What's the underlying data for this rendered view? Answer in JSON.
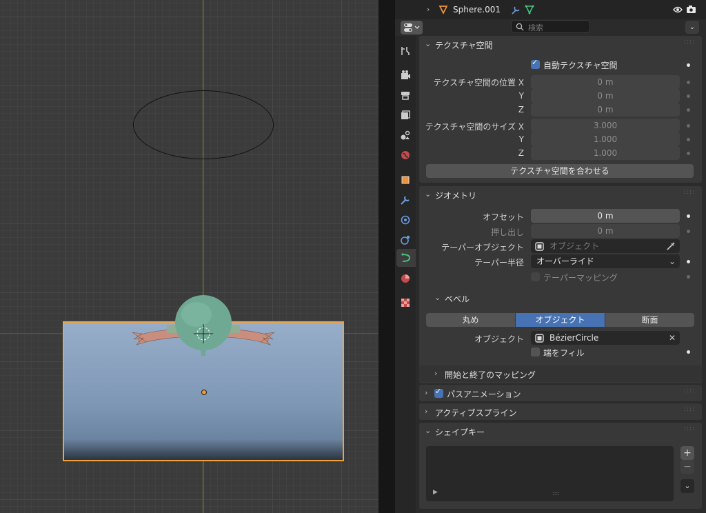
{
  "outliner": {
    "object_name": "Sphere.001"
  },
  "header": {
    "search_placeholder": "検索"
  },
  "texture_space": {
    "title": "テクスチャ空間",
    "auto_label": "自動テクスチャ空間",
    "auto_checked": true,
    "location_label": "テクスチャ空間の位置 X",
    "location": [
      "0 m",
      "0 m",
      "0 m"
    ],
    "size_label": "テクスチャ空間のサイズ X",
    "size": [
      "3.000",
      "1.000",
      "1.000"
    ],
    "axis_y": "Y",
    "axis_z": "Z",
    "match_button": "テクスチャ空間を合わせる"
  },
  "geometry": {
    "title": "ジオメトリ",
    "offset_label": "オフセット",
    "offset_value": "0 m",
    "extrude_label": "押し出し",
    "extrude_value": "0 m",
    "taper_object_label": "テーパーオブジェクト",
    "taper_object_placeholder": "オブジェクト",
    "taper_radius_label": "テーパー半径",
    "taper_radius_value": "オーバーライド",
    "taper_mapping_label": "テーパーマッピング",
    "bevel": {
      "title": "ベベル",
      "modes": [
        "丸め",
        "オブジェクト",
        "断面"
      ],
      "selected_mode": "オブジェクト",
      "object_label": "オブジェクト",
      "object_value": "BézierCircle",
      "fill_caps_label": "端をフィル"
    },
    "start_end_mapping": "開始と終了のマッピング"
  },
  "path_animation": {
    "title": "パスアニメーション",
    "checked": true
  },
  "active_spline": {
    "title": "アクティブスプライン"
  },
  "shape_keys": {
    "title": "シェイプキー"
  },
  "colors": {
    "accent": "#4772b3",
    "selection": "#f3a33a"
  }
}
